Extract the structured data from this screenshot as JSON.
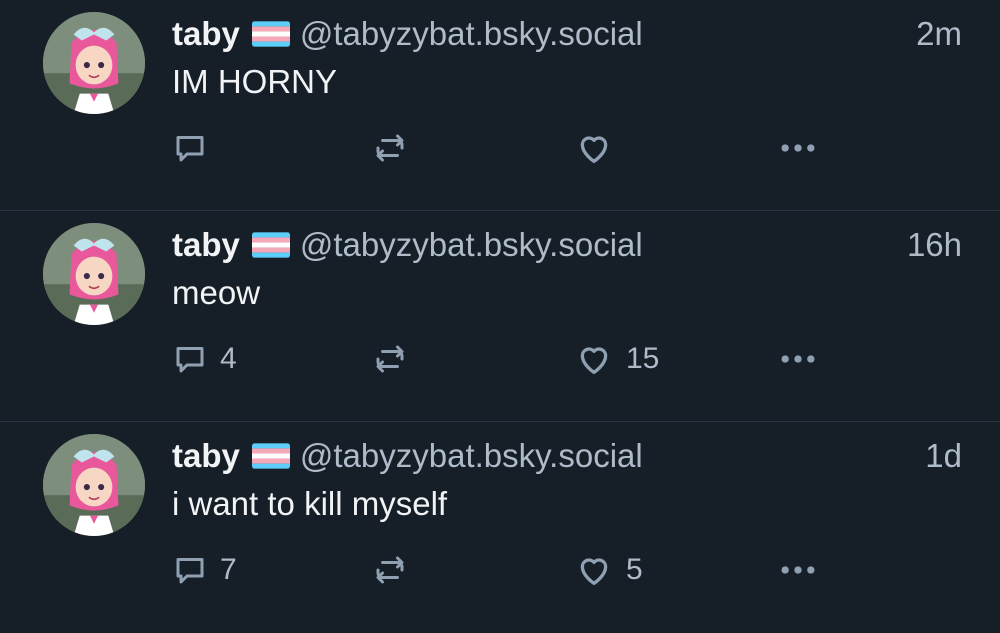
{
  "colors": {
    "background": "#161e27",
    "divider": "#2a3541",
    "primary_text": "#f1f3f5",
    "secondary_text": "#aebbc9",
    "icon": "#8fa0b2",
    "flag_blue": "#5bcefa",
    "flag_pink": "#f5a9b8",
    "flag_white": "#ffffff"
  },
  "posts": [
    {
      "author": {
        "display_name": "taby",
        "flag_icon": "trans-flag-icon",
        "handle": "@tabyzybat.bsky.social",
        "avatar_icon": "anime-girl-avatar"
      },
      "time": "2m",
      "text": "IM HORNY",
      "actions": {
        "reply_count": "",
        "repost_count": "",
        "like_count": ""
      }
    },
    {
      "author": {
        "display_name": "taby",
        "flag_icon": "trans-flag-icon",
        "handle": "@tabyzybat.bsky.social",
        "avatar_icon": "anime-girl-avatar"
      },
      "time": "16h",
      "text": "meow",
      "actions": {
        "reply_count": "4",
        "repost_count": "",
        "like_count": "15"
      }
    },
    {
      "author": {
        "display_name": "taby",
        "flag_icon": "trans-flag-icon",
        "handle": "@tabyzybat.bsky.social",
        "avatar_icon": "anime-girl-avatar"
      },
      "time": "1d",
      "text": "i want to kill myself",
      "actions": {
        "reply_count": "7",
        "repost_count": "",
        "like_count": "5"
      }
    }
  ]
}
